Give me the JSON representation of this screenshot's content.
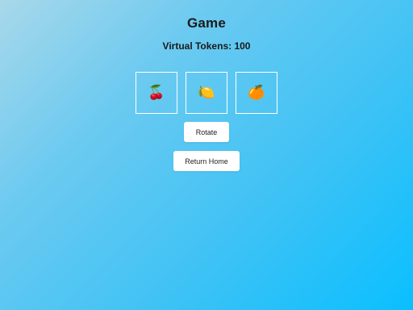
{
  "header": {
    "title": "Game",
    "tokens_label": "Virtual Tokens: 100"
  },
  "reels": [
    {
      "symbol": "🍒",
      "icon": "cherry-icon"
    },
    {
      "symbol": "🍋",
      "icon": "lemon-icon"
    },
    {
      "symbol": "🍊",
      "icon": "orange-icon"
    }
  ],
  "actions": {
    "rotate_label": "Rotate",
    "home_label": "Return Home"
  },
  "colors": {
    "background_start": "#a8d8ea",
    "background_end": "#0abfff",
    "reel_border": "#ffffff",
    "button_bg": "#ffffff"
  }
}
